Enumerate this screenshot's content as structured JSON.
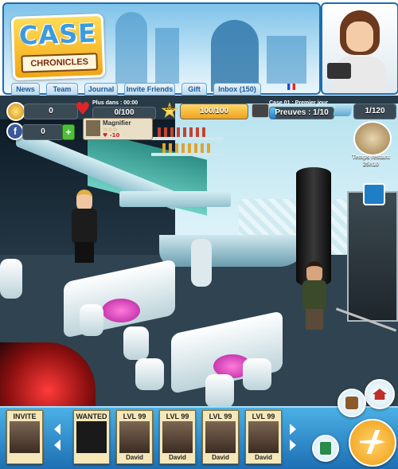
{
  "header": {
    "logo": {
      "line1": "CASE",
      "line2": "CHRONICLES"
    },
    "tabs": [
      "News",
      "Team",
      "Journal",
      "Invite Friends",
      "Gift",
      "Inbox (150)"
    ]
  },
  "hud": {
    "coins": "0",
    "cash": "0",
    "plus": "+",
    "energy": {
      "caption": "Plus dans : 00:00",
      "value": "0/100",
      "fraction": 0
    },
    "stars": {
      "level": "100",
      "value": "100/100",
      "fraction": 1.0
    },
    "case": {
      "caption": "Case 01 : Premier jour",
      "label": "Preuves : 1/10",
      "fraction": 0.1
    },
    "magnifiers": {
      "value": "1/120",
      "fraction": 0.008
    },
    "time_left": {
      "label": "Temps restant",
      "value": "25h10"
    }
  },
  "tooltip": {
    "title": "Magnifier",
    "stars": "☆☆☆",
    "effect": "♥ -10"
  },
  "bottom": {
    "cards": [
      {
        "top": "INVITE",
        "name": ""
      },
      {
        "top": "WANTED",
        "name": ""
      },
      {
        "top": "LVL 99",
        "name": "David"
      },
      {
        "top": "LVL 99",
        "name": "David"
      },
      {
        "top": "LVL 99",
        "name": "David"
      },
      {
        "top": "LVL 99",
        "name": "David"
      }
    ]
  },
  "colors": {
    "accent": "#1d6db0",
    "gold": "#f0a11b",
    "blue_bar": "#1f7fc5"
  }
}
